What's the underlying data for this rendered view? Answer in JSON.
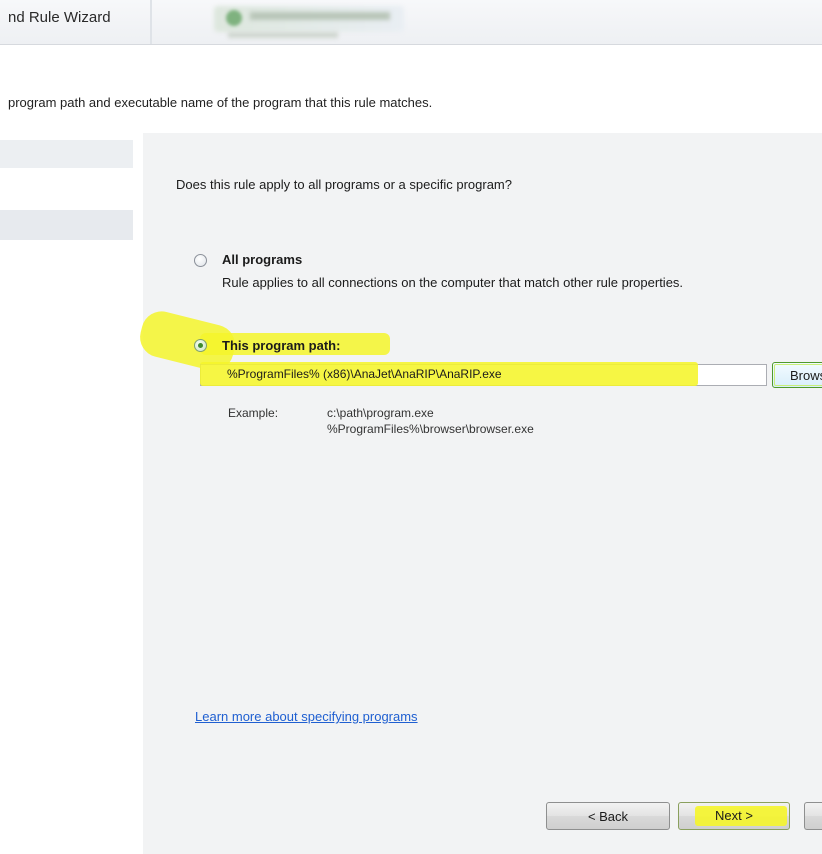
{
  "window": {
    "title": "nd Rule Wizard"
  },
  "header": {
    "description": "program path and executable name of the program that this rule matches."
  },
  "main": {
    "question": "Does this rule apply to all programs or a specific program?",
    "options": [
      {
        "label": "All programs",
        "description": "Rule applies to all connections on the computer that match other rule properties.",
        "selected": false
      },
      {
        "label": "This program path:",
        "selected": true
      }
    ],
    "path_value": "%ProgramFiles% (x86)\\AnaJet\\AnaRIP\\AnaRIP.exe",
    "browse_label": "Browse...",
    "example_label": "Example:",
    "example_lines": [
      "c:\\path\\program.exe",
      "%ProgramFiles%\\browser\\browser.exe"
    ],
    "learn_more_link": "Learn more about specifying programs"
  },
  "footer": {
    "back_label": "< Back",
    "next_label": "Next >"
  },
  "colors": {
    "highlight": "#f5f52a",
    "link": "#1f5fd1",
    "panel_bg": "#f2f3f4"
  }
}
